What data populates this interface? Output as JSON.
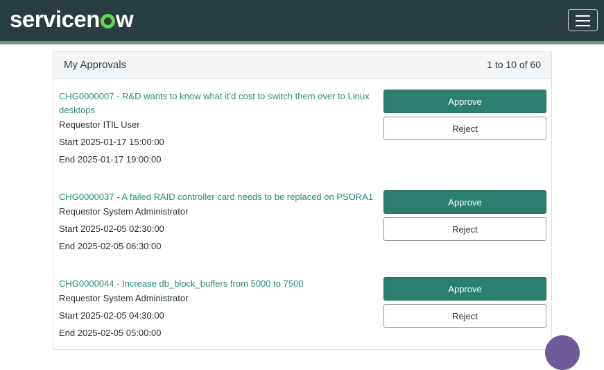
{
  "header": {
    "logo_text": "servicenow",
    "menu_icon": "hamburger-icon"
  },
  "panel": {
    "title": "My Approvals",
    "count": "1 to 10 of 60"
  },
  "approvals": [
    {
      "link": "CHG0000007 - R&D wants to know what it'd cost to switch them over to Linux desktops",
      "requestor": "Requestor ITIL User",
      "start": "Start 2025-01-17 15:00:00",
      "end": "End 2025-01-17 19:00:00",
      "approve_label": "Approve",
      "reject_label": "Reject"
    },
    {
      "link": "CHG0000037 - A failed RAID controller card needs to be replaced on PSORA1",
      "requestor": "Requestor System Administrator",
      "start": "Start 2025-02-05 02:30:00",
      "end": "End 2025-02-05 06:30:00",
      "approve_label": "Approve",
      "reject_label": "Reject"
    },
    {
      "link": "CHG0000044 - Increase db_block_buffers from 5000 to 7500",
      "requestor": "Requestor System Administrator",
      "start": "Start 2025-02-05 04:30:00",
      "end": "End 2025-02-05 05:00:00",
      "approve_label": "Approve",
      "reject_label": "Reject"
    }
  ],
  "colors": {
    "header_bg": "#293e40",
    "accent_green": "#62d84e",
    "approve_bg": "#2a7f6e",
    "link": "#278a7a"
  }
}
